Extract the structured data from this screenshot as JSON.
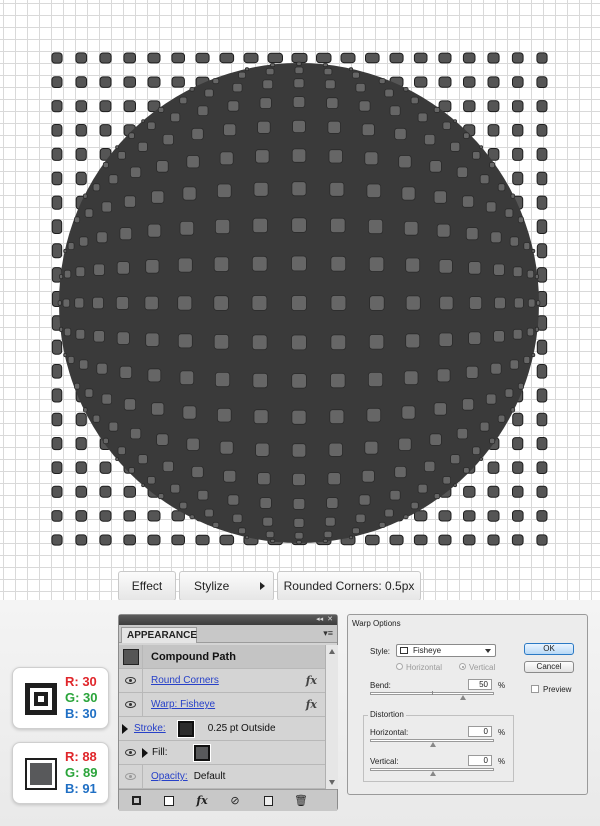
{
  "canvas": {
    "grid_color": "#d9d9d9",
    "tile_color": "#555555",
    "sphere_color": "#3a3a3a"
  },
  "breadcrumb": {
    "items": [
      "Effect",
      "Stylize",
      "Rounded Corners: 0.5px"
    ]
  },
  "colors": [
    {
      "r_label": "R: 30",
      "g_label": "G: 30",
      "b_label": "B: 30",
      "swatch": "#1e1e1e",
      "kind": "stroke"
    },
    {
      "r_label": "R: 88",
      "g_label": "G: 89",
      "b_label": "B: 91",
      "swatch": "#58595b",
      "kind": "fill"
    }
  ],
  "appearance": {
    "tab": "APPEARANCE",
    "header": "Compound Path",
    "rows": {
      "round_corners": "Round Corners",
      "warp": "Warp: Fisheye",
      "stroke_label": "Stroke:",
      "stroke_value": "0.25 pt  Outside",
      "fill_label": "Fill:",
      "opacity_label": "Opacity:",
      "opacity_value": "Default"
    },
    "fx": "fx"
  },
  "warp": {
    "title": "Warp Options",
    "style_label": "Style:",
    "style_value": "Fisheye",
    "horizontal_radio": "Horizontal",
    "vertical_radio": "Vertical",
    "bend_label": "Bend:",
    "bend_value": "50",
    "percent": "%",
    "distortion_label": "Distortion",
    "horizontal_label": "Horizontal:",
    "horizontal_value": "0",
    "vertical_label": "Vertical:",
    "vertical_value": "0",
    "ok": "OK",
    "cancel": "Cancel",
    "preview": "Preview"
  }
}
